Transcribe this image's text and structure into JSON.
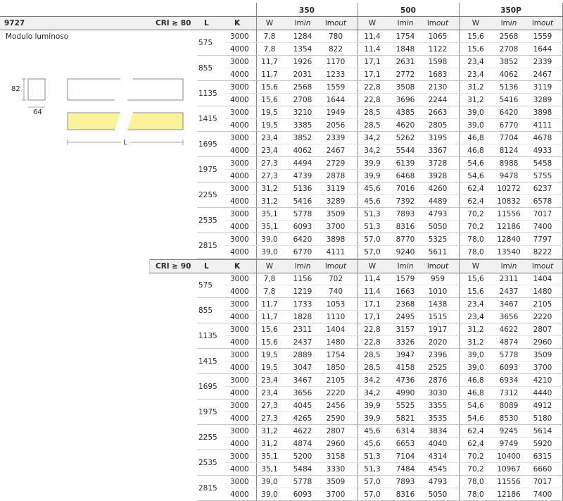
{
  "product_code": "9727",
  "description": "Modulo luminoso",
  "dims": {
    "height": "82",
    "width": "64",
    "length": "L"
  },
  "groups": [
    {
      "cri": "CRI ≥ 80",
      "L_label": "L",
      "K_label": "K",
      "driver_labels": [
        "350",
        "500",
        "350P"
      ],
      "col_labels": [
        "W",
        "lm",
        "lm"
      ],
      "col_suffix": [
        "",
        "in",
        "out"
      ],
      "rows": [
        {
          "L": "575",
          "K": [
            "3000",
            "4000"
          ],
          "v": [
            [
              "7,8",
              "1284",
              "780",
              "11,4",
              "1754",
              "1065",
              "15,6",
              "2568",
              "1559"
            ],
            [
              "7,8",
              "1354",
              "822",
              "11,4",
              "1848",
              "1122",
              "15,6",
              "2708",
              "1644"
            ]
          ]
        },
        {
          "L": "855",
          "K": [
            "3000",
            "4000"
          ],
          "v": [
            [
              "11,7",
              "1926",
              "1170",
              "17,1",
              "2631",
              "1598",
              "23,4",
              "3852",
              "2339"
            ],
            [
              "11,7",
              "2031",
              "1233",
              "17,1",
              "2772",
              "1683",
              "23,4",
              "4062",
              "2467"
            ]
          ]
        },
        {
          "L": "1135",
          "K": [
            "3000",
            "4000"
          ],
          "v": [
            [
              "15,6",
              "2568",
              "1559",
              "22,8",
              "3508",
              "2130",
              "31,2",
              "5136",
              "3119"
            ],
            [
              "15,6",
              "2708",
              "1644",
              "22,8",
              "3696",
              "2244",
              "31,2",
              "5416",
              "3289"
            ]
          ]
        },
        {
          "L": "1415",
          "K": [
            "3000",
            "4000"
          ],
          "v": [
            [
              "19,5",
              "3210",
              "1949",
              "28,5",
              "4385",
              "2663",
              "39,0",
              "6420",
              "3898"
            ],
            [
              "19,5",
              "3385",
              "2056",
              "28,5",
              "4620",
              "2805",
              "39,0",
              "6770",
              "4111"
            ]
          ]
        },
        {
          "L": "1695",
          "K": [
            "3000",
            "4000"
          ],
          "v": [
            [
              "23,4",
              "3852",
              "2339",
              "34,2",
              "5262",
              "3195",
              "46,8",
              "7704",
              "4678"
            ],
            [
              "23,4",
              "4062",
              "2467",
              "34,2",
              "5544",
              "3367",
              "46,8",
              "8124",
              "4933"
            ]
          ]
        },
        {
          "L": "1975",
          "K": [
            "3000",
            "4000"
          ],
          "v": [
            [
              "27,3",
              "4494",
              "2729",
              "39,9",
              "6139",
              "3728",
              "54,6",
              "8988",
              "5458"
            ],
            [
              "27,3",
              "4739",
              "2878",
              "39,9",
              "6468",
              "3928",
              "54,6",
              "9478",
              "5755"
            ]
          ]
        },
        {
          "L": "2255",
          "K": [
            "3000",
            "4000"
          ],
          "v": [
            [
              "31,2",
              "5136",
              "3119",
              "45,6",
              "7016",
              "4260",
              "62,4",
              "10272",
              "6237"
            ],
            [
              "31,2",
              "5416",
              "3289",
              "45,6",
              "7392",
              "4489",
              "62,4",
              "10832",
              "6578"
            ]
          ]
        },
        {
          "L": "2535",
          "K": [
            "3000",
            "4000"
          ],
          "v": [
            [
              "35,1",
              "5778",
              "3509",
              "51,3",
              "7893",
              "4793",
              "70,2",
              "11556",
              "7017"
            ],
            [
              "35,1",
              "6093",
              "3700",
              "51,3",
              "8316",
              "5050",
              "70,2",
              "12186",
              "7400"
            ]
          ]
        },
        {
          "L": "2815",
          "K": [
            "3000",
            "4000"
          ],
          "v": [
            [
              "39,0",
              "6420",
              "3898",
              "57,0",
              "8770",
              "5325",
              "78,0",
              "12840",
              "7797"
            ],
            [
              "39,0",
              "6770",
              "4111",
              "57,0",
              "9240",
              "5611",
              "78,0",
              "13540",
              "8222"
            ]
          ]
        }
      ]
    },
    {
      "cri": "CRI ≥ 90",
      "L_label": "L",
      "K_label": "K",
      "col_labels": [
        "W",
        "lm",
        "lm"
      ],
      "col_suffix": [
        "",
        "in",
        "out"
      ],
      "rows": [
        {
          "L": "575",
          "K": [
            "3000",
            "4000"
          ],
          "v": [
            [
              "7,8",
              "1156",
              "702",
              "11,4",
              "1579",
              "959",
              "15,6",
              "2311",
              "1404"
            ],
            [
              "7,8",
              "1219",
              "740",
              "11,4",
              "1663",
              "1010",
              "15,6",
              "2437",
              "1480"
            ]
          ]
        },
        {
          "L": "855",
          "K": [
            "3000",
            "4000"
          ],
          "v": [
            [
              "11,7",
              "1733",
              "1053",
              "17,1",
              "2368",
              "1438",
              "23,4",
              "3467",
              "2105"
            ],
            [
              "11,7",
              "1828",
              "1110",
              "17,1",
              "2495",
              "1515",
              "23,4",
              "3656",
              "2220"
            ]
          ]
        },
        {
          "L": "1135",
          "K": [
            "3000",
            "4000"
          ],
          "v": [
            [
              "15,6",
              "2311",
              "1404",
              "22,8",
              "3157",
              "1917",
              "31,2",
              "4622",
              "2807"
            ],
            [
              "15,6",
              "2437",
              "1480",
              "22,8",
              "3326",
              "2020",
              "31,2",
              "4874",
              "2960"
            ]
          ]
        },
        {
          "L": "1415",
          "K": [
            "3000",
            "4000"
          ],
          "v": [
            [
              "19,5",
              "2889",
              "1754",
              "28,5",
              "3947",
              "2396",
              "39,0",
              "5778",
              "3509"
            ],
            [
              "19,5",
              "3047",
              "1850",
              "28,5",
              "4158",
              "2525",
              "39,0",
              "6093",
              "3700"
            ]
          ]
        },
        {
          "L": "1695",
          "K": [
            "3000",
            "4000"
          ],
          "v": [
            [
              "23,4",
              "3467",
              "2105",
              "34,2",
              "4736",
              "2876",
              "46,8",
              "6934",
              "4210"
            ],
            [
              "23,4",
              "3656",
              "2220",
              "34,2",
              "4990",
              "3030",
              "46,8",
              "7312",
              "4440"
            ]
          ]
        },
        {
          "L": "1975",
          "K": [
            "3000",
            "4000"
          ],
          "v": [
            [
              "27,3",
              "4045",
              "2456",
              "39,9",
              "5525",
              "3355",
              "54,6",
              "8089",
              "4912"
            ],
            [
              "27,3",
              "4265",
              "2590",
              "39,9",
              "5821",
              "3535",
              "54,6",
              "8530",
              "5180"
            ]
          ]
        },
        {
          "L": "2255",
          "K": [
            "3000",
            "4000"
          ],
          "v": [
            [
              "31,2",
              "4622",
              "2807",
              "45,6",
              "6314",
              "3834",
              "62,4",
              "9245",
              "5614"
            ],
            [
              "31,2",
              "4874",
              "2960",
              "45,6",
              "6653",
              "4040",
              "62,4",
              "9749",
              "5920"
            ]
          ]
        },
        {
          "L": "2535",
          "K": [
            "3000",
            "4000"
          ],
          "v": [
            [
              "35,1",
              "5200",
              "3158",
              "51,3",
              "7104",
              "4314",
              "70,2",
              "10400",
              "6315"
            ],
            [
              "35,1",
              "5484",
              "3330",
              "51,3",
              "7484",
              "4545",
              "70,2",
              "10967",
              "6660"
            ]
          ]
        },
        {
          "L": "2815",
          "K": [
            "3000",
            "4000"
          ],
          "v": [
            [
              "39,0",
              "5778",
              "3509",
              "57,0",
              "7893",
              "4793",
              "78,0",
              "11556",
              "7017"
            ],
            [
              "39,0",
              "6093",
              "3700",
              "57,0",
              "8316",
              "5050",
              "78,0",
              "12186",
              "7400"
            ]
          ]
        }
      ]
    }
  ],
  "colors": {
    "header_bg": "#f1f0ee",
    "led_fill": "#fbf39a",
    "rule": "#777777"
  }
}
